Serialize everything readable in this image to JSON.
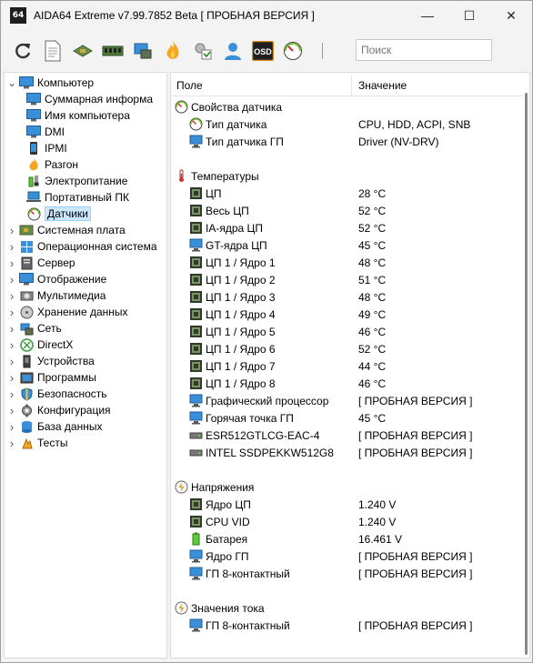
{
  "titlebar": {
    "app_icon_text": "64",
    "title": "AIDA64 Extreme v7.99.7852 Beta  [ ПРОБНАЯ ВЕРСИЯ ]",
    "minimize_glyph": "—",
    "maximize_glyph": "☐",
    "close_glyph": "✕"
  },
  "toolbar": {
    "buttons": [
      "refresh-icon",
      "report-icon",
      "motherboard-icon",
      "memory-icon",
      "network-icon",
      "flame-icon",
      "tools-icon",
      "user-icon",
      "osd-icon",
      "speedometer-icon"
    ],
    "osd_text": "OSD",
    "search_placeholder": "Поиск"
  },
  "tree": {
    "items": [
      {
        "label": "Компьютер",
        "expanded": true,
        "level": 0
      },
      {
        "label": "Суммарная информа",
        "level": 1
      },
      {
        "label": "Имя компьютера",
        "level": 1
      },
      {
        "label": "DMI",
        "level": 1
      },
      {
        "label": "IPMI",
        "level": 1
      },
      {
        "label": "Разгон",
        "level": 1
      },
      {
        "label": "Электропитание",
        "level": 1
      },
      {
        "label": "Портативный ПК",
        "level": 1
      },
      {
        "label": "Датчики",
        "level": 1,
        "selected": true
      },
      {
        "label": "Системная плата",
        "level": 0
      },
      {
        "label": "Операционная система",
        "level": 0
      },
      {
        "label": "Сервер",
        "level": 0
      },
      {
        "label": "Отображение",
        "level": 0
      },
      {
        "label": "Мультимедиа",
        "level": 0
      },
      {
        "label": "Хранение данных",
        "level": 0
      },
      {
        "label": "Сеть",
        "level": 0
      },
      {
        "label": "DirectX",
        "level": 0
      },
      {
        "label": "Устройства",
        "level": 0
      },
      {
        "label": "Программы",
        "level": 0
      },
      {
        "label": "Безопасность",
        "level": 0
      },
      {
        "label": "Конфигурация",
        "level": 0
      },
      {
        "label": "База данных",
        "level": 0
      },
      {
        "label": "Тесты",
        "level": 0
      }
    ]
  },
  "list": {
    "col_field": "Поле",
    "col_value": "Значение",
    "rows": [
      {
        "type": "group",
        "field": "Свойства датчика",
        "icon": "gauge"
      },
      {
        "type": "item",
        "field": "Тип датчика",
        "value": "CPU, HDD, ACPI, SNB",
        "icon": "gauge"
      },
      {
        "type": "item",
        "field": "Тип датчика ГП",
        "value": "Driver  (NV-DRV)",
        "icon": "monitor"
      },
      {
        "type": "blank"
      },
      {
        "type": "group",
        "field": "Температуры",
        "icon": "thermometer"
      },
      {
        "type": "item",
        "field": "ЦП",
        "value": "28 °C",
        "icon": "chip"
      },
      {
        "type": "item",
        "field": "Весь ЦП",
        "value": "52 °C",
        "icon": "chip"
      },
      {
        "type": "item",
        "field": "IA-ядра ЦП",
        "value": "52 °C",
        "icon": "chip"
      },
      {
        "type": "item",
        "field": "GT-ядра ЦП",
        "value": "45 °C",
        "icon": "monitor"
      },
      {
        "type": "item",
        "field": "ЦП 1 / Ядро 1",
        "value": "48 °C",
        "icon": "chip"
      },
      {
        "type": "item",
        "field": "ЦП 1 / Ядро 2",
        "value": "51 °C",
        "icon": "chip"
      },
      {
        "type": "item",
        "field": "ЦП 1 / Ядро 3",
        "value": "48 °C",
        "icon": "chip"
      },
      {
        "type": "item",
        "field": "ЦП 1 / Ядро 4",
        "value": "49 °C",
        "icon": "chip"
      },
      {
        "type": "item",
        "field": "ЦП 1 / Ядро 5",
        "value": "46 °C",
        "icon": "chip"
      },
      {
        "type": "item",
        "field": "ЦП 1 / Ядро 6",
        "value": "52 °C",
        "icon": "chip"
      },
      {
        "type": "item",
        "field": "ЦП 1 / Ядро 7",
        "value": "44 °C",
        "icon": "chip"
      },
      {
        "type": "item",
        "field": "ЦП 1 / Ядро 8",
        "value": "46 °C",
        "icon": "chip"
      },
      {
        "type": "item",
        "field": "Графический процессор",
        "value": "[ ПРОБНАЯ ВЕРСИЯ ]",
        "icon": "monitor"
      },
      {
        "type": "item",
        "field": "Горячая точка ГП",
        "value": "45 °C",
        "icon": "monitor"
      },
      {
        "type": "item",
        "field": "ESR512GTLCG-EAC-4",
        "value": "[ ПРОБНАЯ ВЕРСИЯ ]",
        "icon": "drive"
      },
      {
        "type": "item",
        "field": "INTEL SSDPEKKW512G8",
        "value": "[ ПРОБНАЯ ВЕРСИЯ ]",
        "icon": "drive"
      },
      {
        "type": "blank"
      },
      {
        "type": "group",
        "field": "Напряжения",
        "icon": "bolt"
      },
      {
        "type": "item",
        "field": "Ядро ЦП",
        "value": "1.240 V",
        "icon": "chip"
      },
      {
        "type": "item",
        "field": "CPU VID",
        "value": "1.240 V",
        "icon": "chip"
      },
      {
        "type": "item",
        "field": "Батарея",
        "value": "16.461 V",
        "icon": "battery"
      },
      {
        "type": "item",
        "field": "Ядро ГП",
        "value": "[ ПРОБНАЯ ВЕРСИЯ ]",
        "icon": "monitor"
      },
      {
        "type": "item",
        "field": "ГП 8-контактный",
        "value": "[ ПРОБНАЯ ВЕРСИЯ ]",
        "icon": "monitor"
      },
      {
        "type": "blank"
      },
      {
        "type": "group",
        "field": "Значения тока",
        "icon": "bolt"
      },
      {
        "type": "item",
        "field": "ГП 8-контактный",
        "value": "[ ПРОБНАЯ ВЕРСИЯ ]",
        "icon": "monitor"
      }
    ]
  },
  "colors": {
    "selection_bg": "#cce8ff",
    "chip_green": "#5e7052",
    "monitor_blue": "#3a8fd9"
  }
}
